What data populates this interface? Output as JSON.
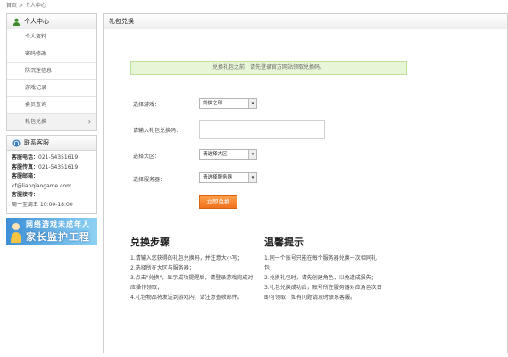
{
  "breadcrumb": "首页 > 个人中心",
  "sidebar": {
    "title": "个人中心",
    "items": [
      {
        "label": "个人资料"
      },
      {
        "label": "密码修改"
      },
      {
        "label": "防沉迷信息"
      },
      {
        "label": "游戏记录"
      },
      {
        "label": "会员查询"
      },
      {
        "label": "礼包兑换",
        "active": true
      }
    ]
  },
  "contact": {
    "title": "联系客服",
    "lines": [
      {
        "label": "客服电话：",
        "value": "021-54351619"
      },
      {
        "label": "客服传真：",
        "value": "021-54351619"
      },
      {
        "label": "客服邮箱：",
        "value": ""
      },
      {
        "label": "",
        "value": "kf@lianqiaogame.com"
      },
      {
        "label": "客服接待：",
        "value": ""
      },
      {
        "label": "",
        "value": "周一至周五 10:00-18:00"
      }
    ]
  },
  "banner": {
    "line1": "网络游戏未成年人",
    "line2": "家长监护工程"
  },
  "main": {
    "title": "礼包兑换",
    "notice": "兑换礼包之前，请先登录官方网站领取兑换码。",
    "form": {
      "game_label": "选择游戏：",
      "game_value": "剑侠之印",
      "code_label": "请输入礼包兑换码：",
      "code_value": "",
      "region_label": "选择大区：",
      "region_value": "请选择大区",
      "server_label": "选择服务器：",
      "server_value": "请选择服务器",
      "submit_label": "立即兑换"
    },
    "steps": {
      "title": "兑换步骤",
      "items": [
        "1.请输入您获得的礼包兑换码，并注意大小写；",
        "2.选择所在大区与服务器；",
        "3.点击\"兑换\"，显示成功提醒后，请登录游戏完成对应操作领取；",
        "4.礼包物品将发送到游戏内，请注意查收邮件。"
      ]
    },
    "tips": {
      "title": "温馨提示",
      "items": [
        "1.同一个账号只能在每个服务器兑换一次相同礼包；",
        "2.兑换礼包时，请先创建角色，以免造成损失；",
        "3.礼包兑换成功后，账号所在服务器对应角色次日即可领取，如有问题请及时联系客服。"
      ]
    }
  },
  "colors": {
    "accent": "#f0721c",
    "notice_bg": "#e8f6d8",
    "banner": "#3d8fd6"
  }
}
